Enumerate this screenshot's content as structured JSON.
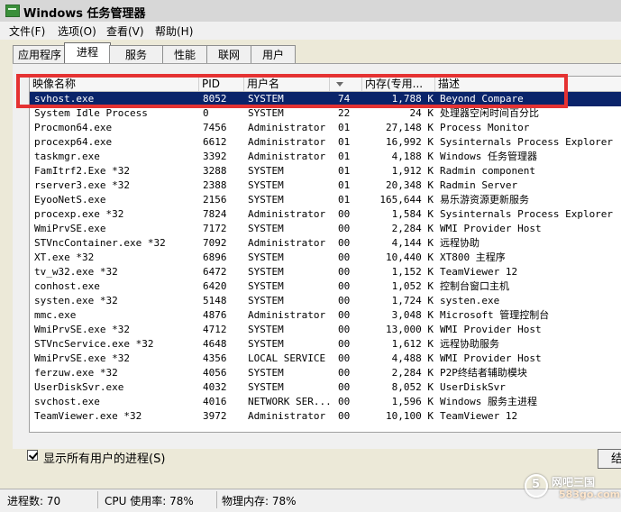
{
  "window": {
    "title": "Windows 任务管理器"
  },
  "menu": [
    "文件(F)",
    "选项(O)",
    "查看(V)",
    "帮助(H)"
  ],
  "tabs": [
    "应用程序",
    "进程",
    "服务",
    "性能",
    "联网",
    "用户"
  ],
  "columns": [
    "映像名称",
    "PID",
    "用户名",
    "",
    "内存(专用...",
    "描述"
  ],
  "processes": [
    {
      "name": "svhost.exe",
      "pid": "8052",
      "user": "SYSTEM",
      "cpu": "74",
      "mem": "1,788 K",
      "desc": "Beyond Compare"
    },
    {
      "name": "System Idle Process",
      "pid": "0",
      "user": "SYSTEM",
      "cpu": "22",
      "mem": "24 K",
      "desc": "处理器空闲时间百分比"
    },
    {
      "name": "Procmon64.exe",
      "pid": "7456",
      "user": "Administrator",
      "cpu": "01",
      "mem": "27,148 K",
      "desc": "Process Monitor"
    },
    {
      "name": "procexp64.exe",
      "pid": "6612",
      "user": "Administrator",
      "cpu": "01",
      "mem": "16,992 K",
      "desc": "Sysinternals Process Explorer"
    },
    {
      "name": "taskmgr.exe",
      "pid": "3392",
      "user": "Administrator",
      "cpu": "01",
      "mem": "4,188 K",
      "desc": "Windows 任务管理器"
    },
    {
      "name": "FamItrf2.Exe *32",
      "pid": "3288",
      "user": "SYSTEM",
      "cpu": "01",
      "mem": "1,912 K",
      "desc": "Radmin component"
    },
    {
      "name": "rserver3.exe *32",
      "pid": "2388",
      "user": "SYSTEM",
      "cpu": "01",
      "mem": "20,348 K",
      "desc": "Radmin Server"
    },
    {
      "name": "EyooNetS.exe",
      "pid": "2156",
      "user": "SYSTEM",
      "cpu": "01",
      "mem": "165,644 K",
      "desc": "易乐游资源更新服务"
    },
    {
      "name": "procexp.exe *32",
      "pid": "7824",
      "user": "Administrator",
      "cpu": "00",
      "mem": "1,584 K",
      "desc": "Sysinternals Process Explorer"
    },
    {
      "name": "WmiPrvSE.exe",
      "pid": "7172",
      "user": "SYSTEM",
      "cpu": "00",
      "mem": "2,284 K",
      "desc": "WMI Provider Host"
    },
    {
      "name": "STVncContainer.exe *32",
      "pid": "7092",
      "user": "Administrator",
      "cpu": "00",
      "mem": "4,144 K",
      "desc": "远程协助"
    },
    {
      "name": "XT.exe *32",
      "pid": "6896",
      "user": "SYSTEM",
      "cpu": "00",
      "mem": "10,440 K",
      "desc": "XT800 主程序"
    },
    {
      "name": "tv_w32.exe *32",
      "pid": "6472",
      "user": "SYSTEM",
      "cpu": "00",
      "mem": "1,152 K",
      "desc": "TeamViewer 12"
    },
    {
      "name": "conhost.exe",
      "pid": "6420",
      "user": "SYSTEM",
      "cpu": "00",
      "mem": "1,052 K",
      "desc": "控制台窗口主机"
    },
    {
      "name": "systen.exe *32",
      "pid": "5148",
      "user": "SYSTEM",
      "cpu": "00",
      "mem": "1,724 K",
      "desc": "systen.exe"
    },
    {
      "name": "mmc.exe",
      "pid": "4876",
      "user": "Administrator",
      "cpu": "00",
      "mem": "3,048 K",
      "desc": "Microsoft 管理控制台"
    },
    {
      "name": "WmiPrvSE.exe *32",
      "pid": "4712",
      "user": "SYSTEM",
      "cpu": "00",
      "mem": "13,000 K",
      "desc": "WMI Provider Host"
    },
    {
      "name": "STVncService.exe *32",
      "pid": "4648",
      "user": "SYSTEM",
      "cpu": "00",
      "mem": "1,612 K",
      "desc": "远程协助服务"
    },
    {
      "name": "WmiPrvSE.exe *32",
      "pid": "4356",
      "user": "LOCAL SERVICE",
      "cpu": "00",
      "mem": "4,488 K",
      "desc": "WMI Provider Host"
    },
    {
      "name": "ferzuw.exe *32",
      "pid": "4056",
      "user": "SYSTEM",
      "cpu": "00",
      "mem": "2,284 K",
      "desc": "P2P终结者辅助模块"
    },
    {
      "name": "UserDiskSvr.exe",
      "pid": "4032",
      "user": "SYSTEM",
      "cpu": "00",
      "mem": "8,052 K",
      "desc": "UserDiskSvr"
    },
    {
      "name": "svchost.exe",
      "pid": "4016",
      "user": "NETWORK SER...",
      "cpu": "00",
      "mem": "1,596 K",
      "desc": "Windows 服务主进程"
    },
    {
      "name": "TeamViewer.exe *32",
      "pid": "3972",
      "user": "Administrator",
      "cpu": "00",
      "mem": "10,100 K",
      "desc": "TeamViewer 12"
    }
  ],
  "show_all_label": "显示所有用户的进程(S)",
  "end_button_label": "结",
  "status": {
    "process_count": "进程数: 70",
    "cpu_usage": "CPU 使用率: 78%",
    "physical_memory": "物理内存: 78%"
  },
  "watermark": {
    "site_name": "网吧三国",
    "url": "583go.com",
    "logo_digit": "5"
  },
  "colors": {
    "selection": "#0a246a",
    "highlight_box": "#e53232"
  }
}
